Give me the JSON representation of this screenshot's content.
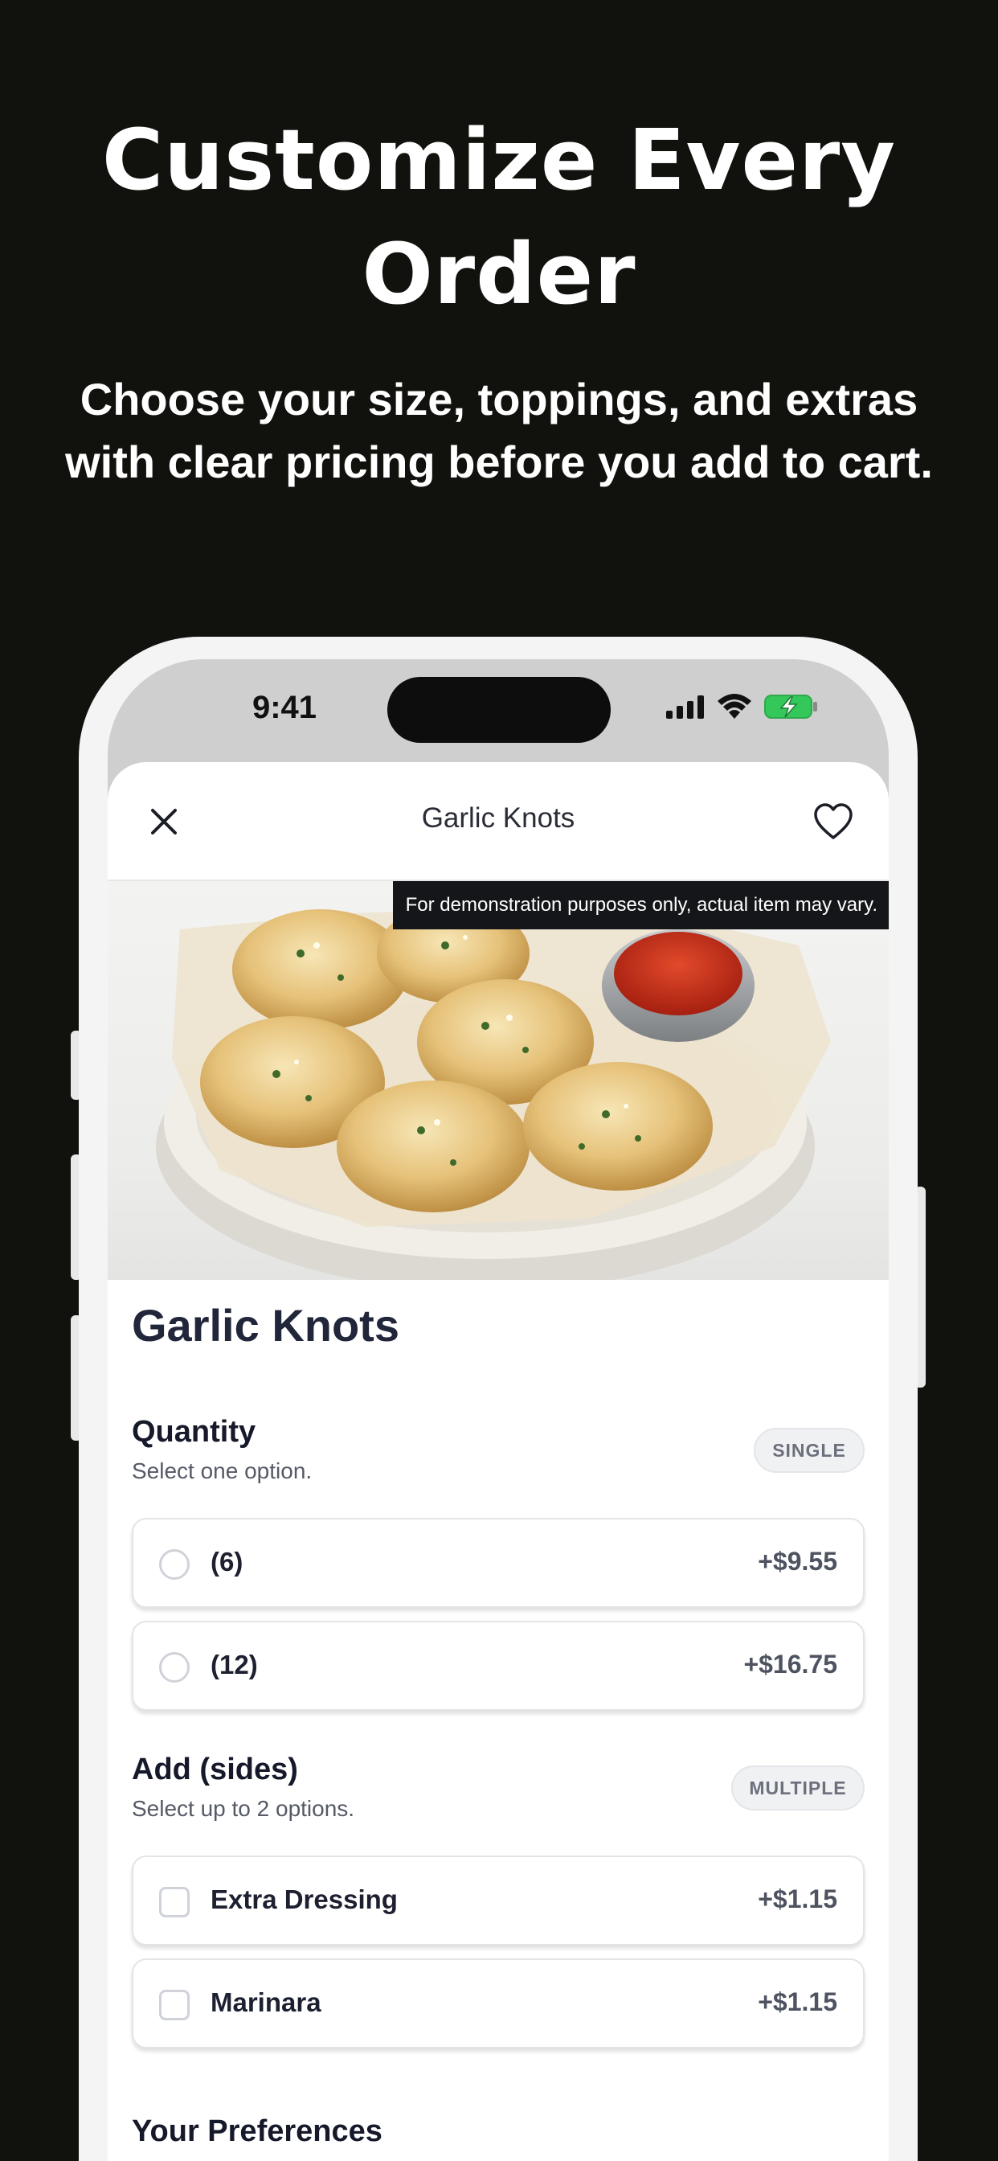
{
  "promo": {
    "headline": "Customize Every Order",
    "subline": "Choose your size, toppings, and extras with clear pricing before you add to cart."
  },
  "status_bar": {
    "time": "9:41",
    "icons": [
      "cellular-signal-icon",
      "wifi-icon",
      "battery-charging-icon"
    ]
  },
  "nav": {
    "title": "Garlic Knots",
    "close_icon": "close-icon",
    "favorite_icon": "heart-icon"
  },
  "hero": {
    "disclaimer": "For demonstration purposes only, actual item may vary."
  },
  "item": {
    "title": "Garlic Knots"
  },
  "sections": {
    "quantity": {
      "title": "Quantity",
      "subtitle": "Select one option.",
      "badge": "SINGLE",
      "options": [
        {
          "label": "(6)",
          "price": "+$9.55"
        },
        {
          "label": "(12)",
          "price": "+$16.75"
        }
      ]
    },
    "sides": {
      "title": "Add (sides)",
      "subtitle": "Select up to 2 options.",
      "badge": "MULTIPLE",
      "options": [
        {
          "label": "Extra Dressing",
          "price": "+$1.15"
        },
        {
          "label": "Marinara",
          "price": "+$1.15"
        }
      ]
    },
    "preferences": {
      "title": "Your Preferences"
    }
  },
  "colors": {
    "background": "#11120d",
    "phone_frame": "#f4f4f4",
    "text_dark": "#1f2330",
    "price_gray": "#4e5360",
    "charging_green": "#34c759"
  }
}
